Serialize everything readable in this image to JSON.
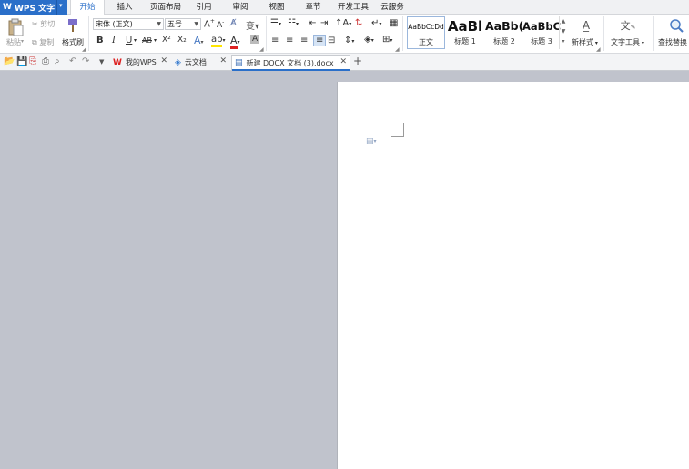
{
  "app": {
    "logo_text": "WPS 文字",
    "logo_mark": "W"
  },
  "menu": {
    "tabs": [
      "开始",
      "插入",
      "页面布局",
      "引用",
      "审阅",
      "视图",
      "章节",
      "开发工具",
      "云服务"
    ],
    "active_tab": "开始"
  },
  "ribbon": {
    "clipboard": {
      "paste": "粘贴",
      "cut": "剪切",
      "copy": "复制",
      "format_painter": "格式刷"
    },
    "font": {
      "name": "宋体 (正文)",
      "size": "五号",
      "bold": "B",
      "italic": "I",
      "underline": "U",
      "strike": "AB",
      "superscript": "X²",
      "subscript": "X₂",
      "font_color": "A"
    },
    "styles": [
      {
        "sample": "AaBbCcDd",
        "name": "正文"
      },
      {
        "sample": "AaBl",
        "name": "标题 1"
      },
      {
        "sample": "AaBb(",
        "name": "标题 2"
      },
      {
        "sample": "AaBbC",
        "name": "标题 3"
      }
    ],
    "new_style": "新样式",
    "text_tools": "文字工具",
    "find_replace": "查找替换"
  },
  "doc_tabs": [
    {
      "label": "我的WPS"
    },
    {
      "label": "云文档"
    },
    {
      "label": "新建 DOCX 文档 (3).docx",
      "active": true
    }
  ],
  "colors": {
    "accent": "#2a6fc9",
    "workspace": "#c0c3cc",
    "page": "#ffffff"
  }
}
